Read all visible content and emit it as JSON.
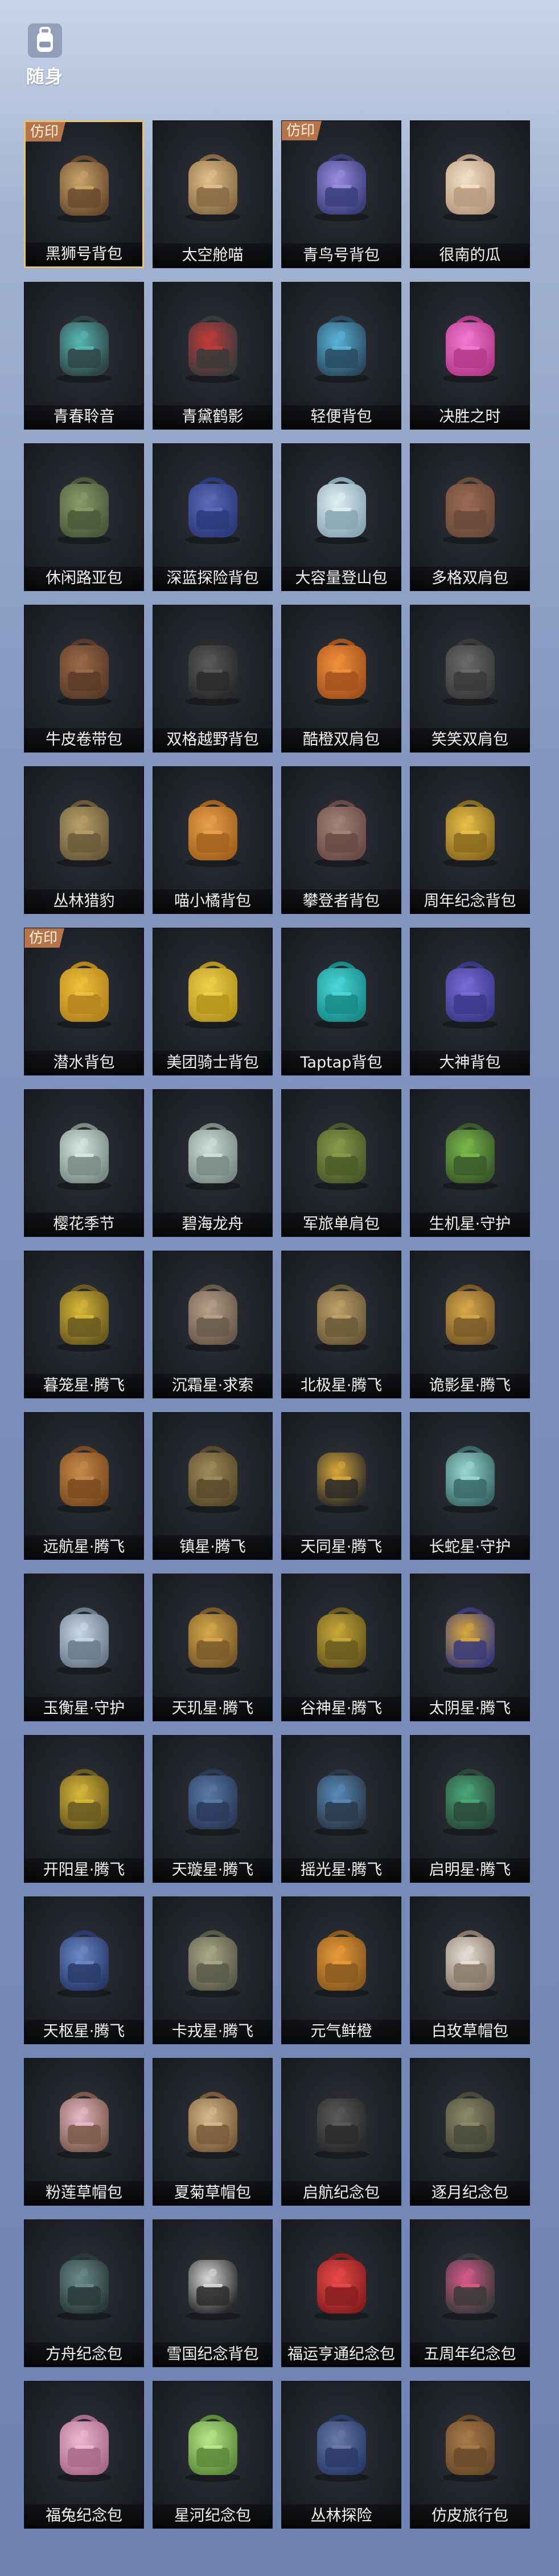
{
  "header": {
    "title": "随身",
    "icon": "backpack-icon"
  },
  "tag_text": "仿印",
  "items": [
    {
      "name": "黑狮号背包",
      "tag": true,
      "selected": true,
      "colors": [
        "#6b4a2e",
        "#c9a46a"
      ]
    },
    {
      "name": "太空舱喵",
      "tag": false,
      "colors": [
        "#8a6a44",
        "#e0c08a"
      ]
    },
    {
      "name": "青鸟号背包",
      "tag": true,
      "colors": [
        "#3a3f7a",
        "#9a8ae0"
      ]
    },
    {
      "name": "很南的瓜",
      "tag": false,
      "colors": [
        "#b89a7e",
        "#f2e0c8"
      ]
    },
    {
      "name": "青春聆音",
      "tag": false,
      "colors": [
        "#2e4446",
        "#58b8b4"
      ]
    },
    {
      "name": "青黛鹤影",
      "tag": false,
      "colors": [
        "#3a3a3a",
        "#c23a3a"
      ]
    },
    {
      "name": "轻便背包",
      "tag": false,
      "colors": [
        "#2a4a62",
        "#5ab4d8"
      ]
    },
    {
      "name": "决胜之时",
      "tag": false,
      "colors": [
        "#b43a8a",
        "#f07ad2"
      ]
    },
    {
      "name": "休闲路亚包",
      "tag": false,
      "colors": [
        "#4a5a3a",
        "#8a9a6a"
      ]
    },
    {
      "name": "深蓝探险背包",
      "tag": false,
      "colors": [
        "#2a3a7a",
        "#5a6ab8"
      ]
    },
    {
      "name": "大容量登山包",
      "tag": false,
      "colors": [
        "#8aa6b4",
        "#e0f0f4"
      ]
    },
    {
      "name": "多格双肩包",
      "tag": false,
      "colors": [
        "#6a4a3a",
        "#9a6a52"
      ]
    },
    {
      "name": "牛皮卷带包",
      "tag": false,
      "colors": [
        "#5a3a28",
        "#9a6a48"
      ]
    },
    {
      "name": "双格越野背包",
      "tag": false,
      "colors": [
        "#2a2a2a",
        "#5a5a5a"
      ]
    },
    {
      "name": "酷橙双肩包",
      "tag": false,
      "colors": [
        "#a4521e",
        "#f0903a"
      ]
    },
    {
      "name": "笑笑双肩包",
      "tag": false,
      "colors": [
        "#3a3a3a",
        "#6a6a6a"
      ]
    },
    {
      "name": "丛林猎豹",
      "tag": false,
      "colors": [
        "#6a5a3a",
        "#b8a06a"
      ]
    },
    {
      "name": "喵小橘背包",
      "tag": false,
      "colors": [
        "#a4621e",
        "#e8a04a"
      ]
    },
    {
      "name": "攀登者背包",
      "tag": false,
      "colors": [
        "#6a4a44",
        "#a48478"
      ]
    },
    {
      "name": "周年纪念背包",
      "tag": false,
      "colors": [
        "#8a6a1e",
        "#e8c04a"
      ]
    },
    {
      "name": "潜水背包",
      "tag": true,
      "colors": [
        "#b4841e",
        "#f0c03a"
      ]
    },
    {
      "name": "美团骑士背包",
      "tag": false,
      "colors": [
        "#b4941e",
        "#f0d04a"
      ]
    },
    {
      "name": "Taptap背包",
      "tag": false,
      "colors": [
        "#1a8a8a",
        "#4ad8d8"
      ]
    },
    {
      "name": "大神背包",
      "tag": false,
      "colors": [
        "#3a3a8a",
        "#7a6ad8"
      ]
    },
    {
      "name": "樱花季节",
      "tag": false,
      "colors": [
        "#7a8a84",
        "#d8e8e0"
      ]
    },
    {
      "name": "碧海龙舟",
      "tag": false,
      "colors": [
        "#7a8a84",
        "#d0e0d8"
      ]
    },
    {
      "name": "军旅单肩包",
      "tag": false,
      "colors": [
        "#4a5a2a",
        "#8a9a4a"
      ]
    },
    {
      "name": "生机星·守护",
      "tag": false,
      "colors": [
        "#3a5a2a",
        "#7ab84a"
      ]
    },
    {
      "name": "暮笼星·腾飞",
      "tag": false,
      "colors": [
        "#6a5a1e",
        "#d8b83a"
      ]
    },
    {
      "name": "沉霜星·求索",
      "tag": false,
      "colors": [
        "#6a5a4a",
        "#b8a08a"
      ]
    },
    {
      "name": "北极星·腾飞",
      "tag": false,
      "colors": [
        "#6a5a3a",
        "#c0a068"
      ]
    },
    {
      "name": "诡影星·腾飞",
      "tag": false,
      "colors": [
        "#7a5a2a",
        "#d8a84a"
      ]
    },
    {
      "name": "远航星·腾飞",
      "tag": false,
      "colors": [
        "#7a4a1e",
        "#c88a4a"
      ]
    },
    {
      "name": "镇星·腾飞",
      "tag": false,
      "colors": [
        "#5a4a2a",
        "#a08a5a"
      ]
    },
    {
      "name": "天同星·腾飞",
      "tag": false,
      "colors": [
        "#2a2a2a",
        "#d8a83a"
      ]
    },
    {
      "name": "长蛇星·守护",
      "tag": false,
      "colors": [
        "#3a6a6a",
        "#9ad8d0"
      ]
    },
    {
      "name": "玉衡星·守护",
      "tag": false,
      "colors": [
        "#6a7a8a",
        "#c8d8e8"
      ]
    },
    {
      "name": "天玑星·腾飞",
      "tag": false,
      "colors": [
        "#7a5a2a",
        "#d8a84a"
      ]
    },
    {
      "name": "谷神星·腾飞",
      "tag": false,
      "colors": [
        "#6a5a1e",
        "#c8a83a"
      ]
    },
    {
      "name": "太阴星·腾飞",
      "tag": false,
      "colors": [
        "#3a3a7a",
        "#d8a83a"
      ]
    },
    {
      "name": "开阳星·腾飞",
      "tag": false,
      "colors": [
        "#6a5a1e",
        "#d8b83a"
      ]
    },
    {
      "name": "天璇星·腾飞",
      "tag": false,
      "colors": [
        "#2a3a5a",
        "#5a7aa8"
      ]
    },
    {
      "name": "摇光星·腾飞",
      "tag": false,
      "colors": [
        "#2a3a4a",
        "#5a8ab8"
      ]
    },
    {
      "name": "启明星·腾飞",
      "tag": false,
      "colors": [
        "#2a4a3a",
        "#4aa87a"
      ]
    },
    {
      "name": "天枢星·腾飞",
      "tag": false,
      "colors": [
        "#2a3a6a",
        "#6a8ac8"
      ]
    },
    {
      "name": "卡戎星·腾飞",
      "tag": false,
      "colors": [
        "#5a5a4a",
        "#a8a888"
      ]
    },
    {
      "name": "元气鲜橙",
      "tag": false,
      "colors": [
        "#8a5a1e",
        "#e89a3a"
      ]
    },
    {
      "name": "白玫草帽包",
      "tag": false,
      "colors": [
        "#8a7a6a",
        "#e8e0d8"
      ]
    },
    {
      "name": "粉莲草帽包",
      "tag": false,
      "colors": [
        "#7a5a4a",
        "#e8b8c8"
      ]
    },
    {
      "name": "夏菊草帽包",
      "tag": false,
      "colors": [
        "#7a5a3a",
        "#d8b88a"
      ]
    },
    {
      "name": "启航纪念包",
      "tag": false,
      "colors": [
        "#2a2a2a",
        "#5a5a5a"
      ]
    },
    {
      "name": "逐月纪念包",
      "tag": false,
      "colors": [
        "#4a4a3a",
        "#8a8a6a"
      ]
    },
    {
      "name": "方舟纪念包",
      "tag": false,
      "colors": [
        "#2a3a3a",
        "#6a8a8a"
      ]
    },
    {
      "name": "雪国纪念背包",
      "tag": false,
      "colors": [
        "#2a2a2a",
        "#d8d8d8"
      ]
    },
    {
      "name": "福运亨通纪念包",
      "tag": false,
      "colors": [
        "#8a1e1e",
        "#e84a4a"
      ]
    },
    {
      "name": "五周年纪念包",
      "tag": false,
      "colors": [
        "#3a3a3a",
        "#d85a8a"
      ]
    },
    {
      "name": "福兔纪念包",
      "tag": false,
      "colors": [
        "#a86a8a",
        "#f0b8d0"
      ]
    },
    {
      "name": "星河纪念包",
      "tag": false,
      "colors": [
        "#5a8a3a",
        "#b8e88a"
      ]
    },
    {
      "name": "丛林探险",
      "tag": false,
      "colors": [
        "#2a3a6a",
        "#6a7aa8"
      ]
    },
    {
      "name": "仿皮旅行包",
      "tag": false,
      "colors": [
        "#6a4a2a",
        "#a87a4a"
      ]
    }
  ]
}
